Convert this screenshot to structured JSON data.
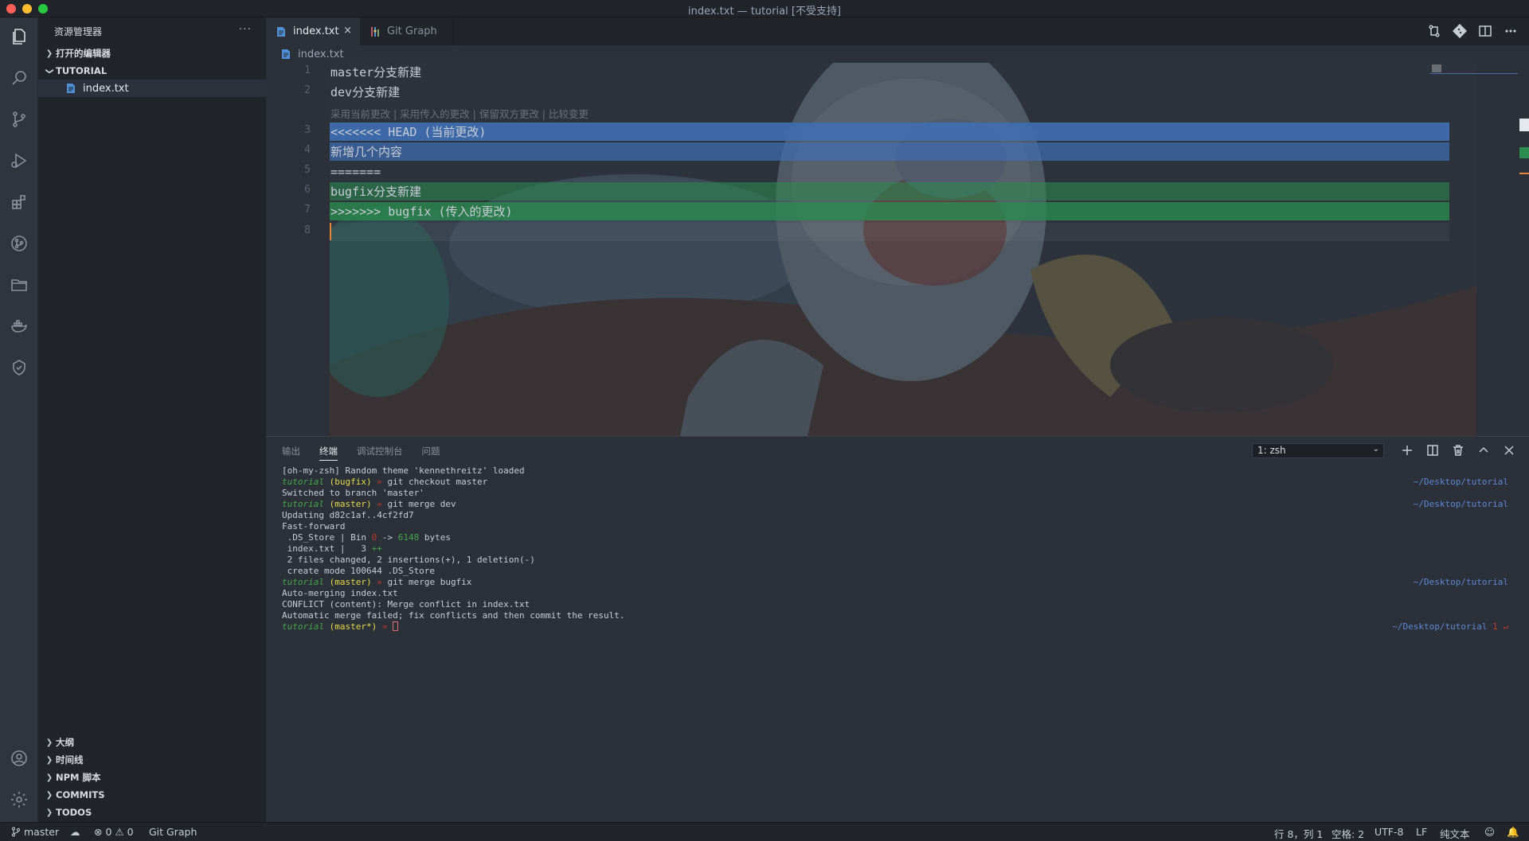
{
  "window": {
    "title": "index.txt — tutorial [不受支持]"
  },
  "sidebar": {
    "header": "资源管理器",
    "more": "···",
    "open_editors": "打开的编辑器",
    "folder": "TUTORIAL",
    "file": "index.txt",
    "bottom_sections": [
      "大纲",
      "时间线",
      "NPM 脚本",
      "COMMITS",
      "TODOS"
    ]
  },
  "tabs": [
    {
      "label": "index.txt",
      "close": "×"
    },
    {
      "label": "Git Graph"
    }
  ],
  "breadcrumb": "index.txt",
  "editor": {
    "codelens": "采用当前更改 | 采用传入的更改 | 保留双方更改 | 比较变更",
    "lines": [
      {
        "num": "1",
        "text": "master分支新建"
      },
      {
        "num": "2",
        "text": "dev分支新建"
      },
      {
        "num": "3",
        "text": "<<<<<<< HEAD (当前更改)"
      },
      {
        "num": "4",
        "text": "新增几个内容"
      },
      {
        "num": "5",
        "text": "======="
      },
      {
        "num": "6",
        "text": "bugfix分支新建"
      },
      {
        "num": "7",
        "text": ">>>>>>> bugfix (传入的更改)"
      },
      {
        "num": "8",
        "text": ""
      }
    ]
  },
  "panel": {
    "tabs": [
      "输出",
      "终端",
      "调试控制台",
      "问题"
    ],
    "terminal_select": "1: zsh",
    "terminal": {
      "l1": "[oh-my-zsh] Random theme 'kennethreitz' loaded",
      "prompt_dir": "tutorial",
      "branch_bugfix": "(bugfix)",
      "branch_master": "(master)",
      "branch_master_dirty": "(master*)",
      "arrow": "»",
      "cmd1": "git checkout master",
      "l3": "Switched to branch 'master'",
      "cmd2": "git merge dev",
      "l5": "Updating d82c1af..4cf2fd7",
      "l6": "Fast-forward",
      "l7a": " .DS_Store | Bin ",
      "l7b": "0",
      "l7c": " -> ",
      "l7d": "6148",
      "l7e": " bytes",
      "l8a": " index.txt |   3 ",
      "l8b": "++",
      "l9": " 2 files changed, 2 insertions(+), 1 deletion(-)",
      "l10": " create mode 100644 .DS_Store",
      "cmd3": "git merge bugfix",
      "l12": "Auto-merging index.txt",
      "l13": "CONFLICT (content): Merge conflict in index.txt",
      "l14": "Automatic merge failed; fix conflicts and then commit the result.",
      "rp": "~/Desktop/tutorial",
      "rp_last": "1 ↵"
    }
  },
  "status": {
    "branch": "master",
    "errors": "0",
    "warnings": "0",
    "git_graph": "Git Graph",
    "position": "行 8，列 1",
    "spaces": "空格: 2",
    "encoding": "UTF-8",
    "eol": "LF",
    "lang": "纯文本"
  },
  "colors": {
    "current_change": "#406eb2",
    "incoming_change": "#2a8c4e",
    "accent": "#e5853a"
  }
}
